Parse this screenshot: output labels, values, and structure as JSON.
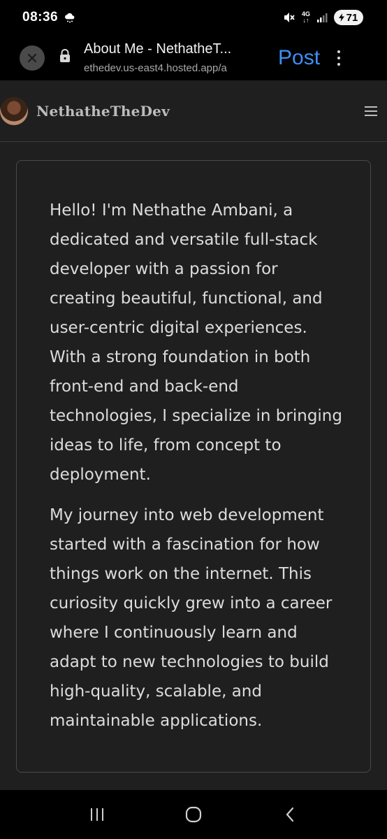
{
  "status_bar": {
    "time": "08:36",
    "network": "4G",
    "battery": "71",
    "icons": [
      "weather-cloud-icon",
      "mute-icon",
      "signal-icon",
      "battery-icon"
    ]
  },
  "browser": {
    "page_title": "About Me - NethatheT...",
    "url": "ethedev.us-east4.hosted.app/a",
    "action_label": "Post",
    "colors": {
      "action": "#3d8ff5"
    }
  },
  "site": {
    "brand": "NethatheTheDev"
  },
  "content": {
    "paragraphs": [
      "Hello! I'm Nethathe Ambani, a dedicated and versatile full-stack developer with a passion for creating beautiful, functional, and user-centric digital experiences. With a strong foundation in both front-end and back-end technologies, I specialize in bringing ideas to life, from concept to deployment.",
      "My journey into web development started with a fascination for how things work on the internet. This curiosity quickly grew into a career where I continuously learn and adapt to new technologies to build high-quality, scalable, and maintainable applications."
    ]
  },
  "nav_bar": {
    "buttons": [
      "recents-icon",
      "home-icon",
      "back-icon"
    ]
  }
}
